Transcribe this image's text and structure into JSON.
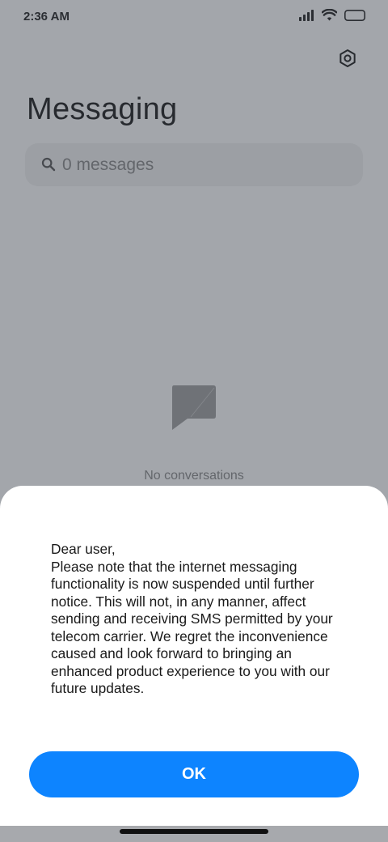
{
  "status_bar": {
    "time": "2:36 AM",
    "icons": [
      "signal-icon",
      "wifi-icon",
      "battery-icon"
    ]
  },
  "header": {
    "title": "Messaging",
    "settings_icon": "gear-icon"
  },
  "search": {
    "placeholder": "0 messages",
    "value": ""
  },
  "empty_state": {
    "icon": "chat-bubble-icon",
    "text": "No conversations"
  },
  "dialog": {
    "message": "Dear user,\nPlease note that the internet messaging functionality is now suspended until further notice. This will not, in any manner, affect sending and receiving SMS permitted by your telecom carrier. We regret the inconvenience caused and look forward to bringing an enhanced product experience to you with our future updates.",
    "ok_label": "OK"
  },
  "colors": {
    "accent": "#0d84ff",
    "scrim": "#373e48",
    "text": "#1a1a1a"
  }
}
